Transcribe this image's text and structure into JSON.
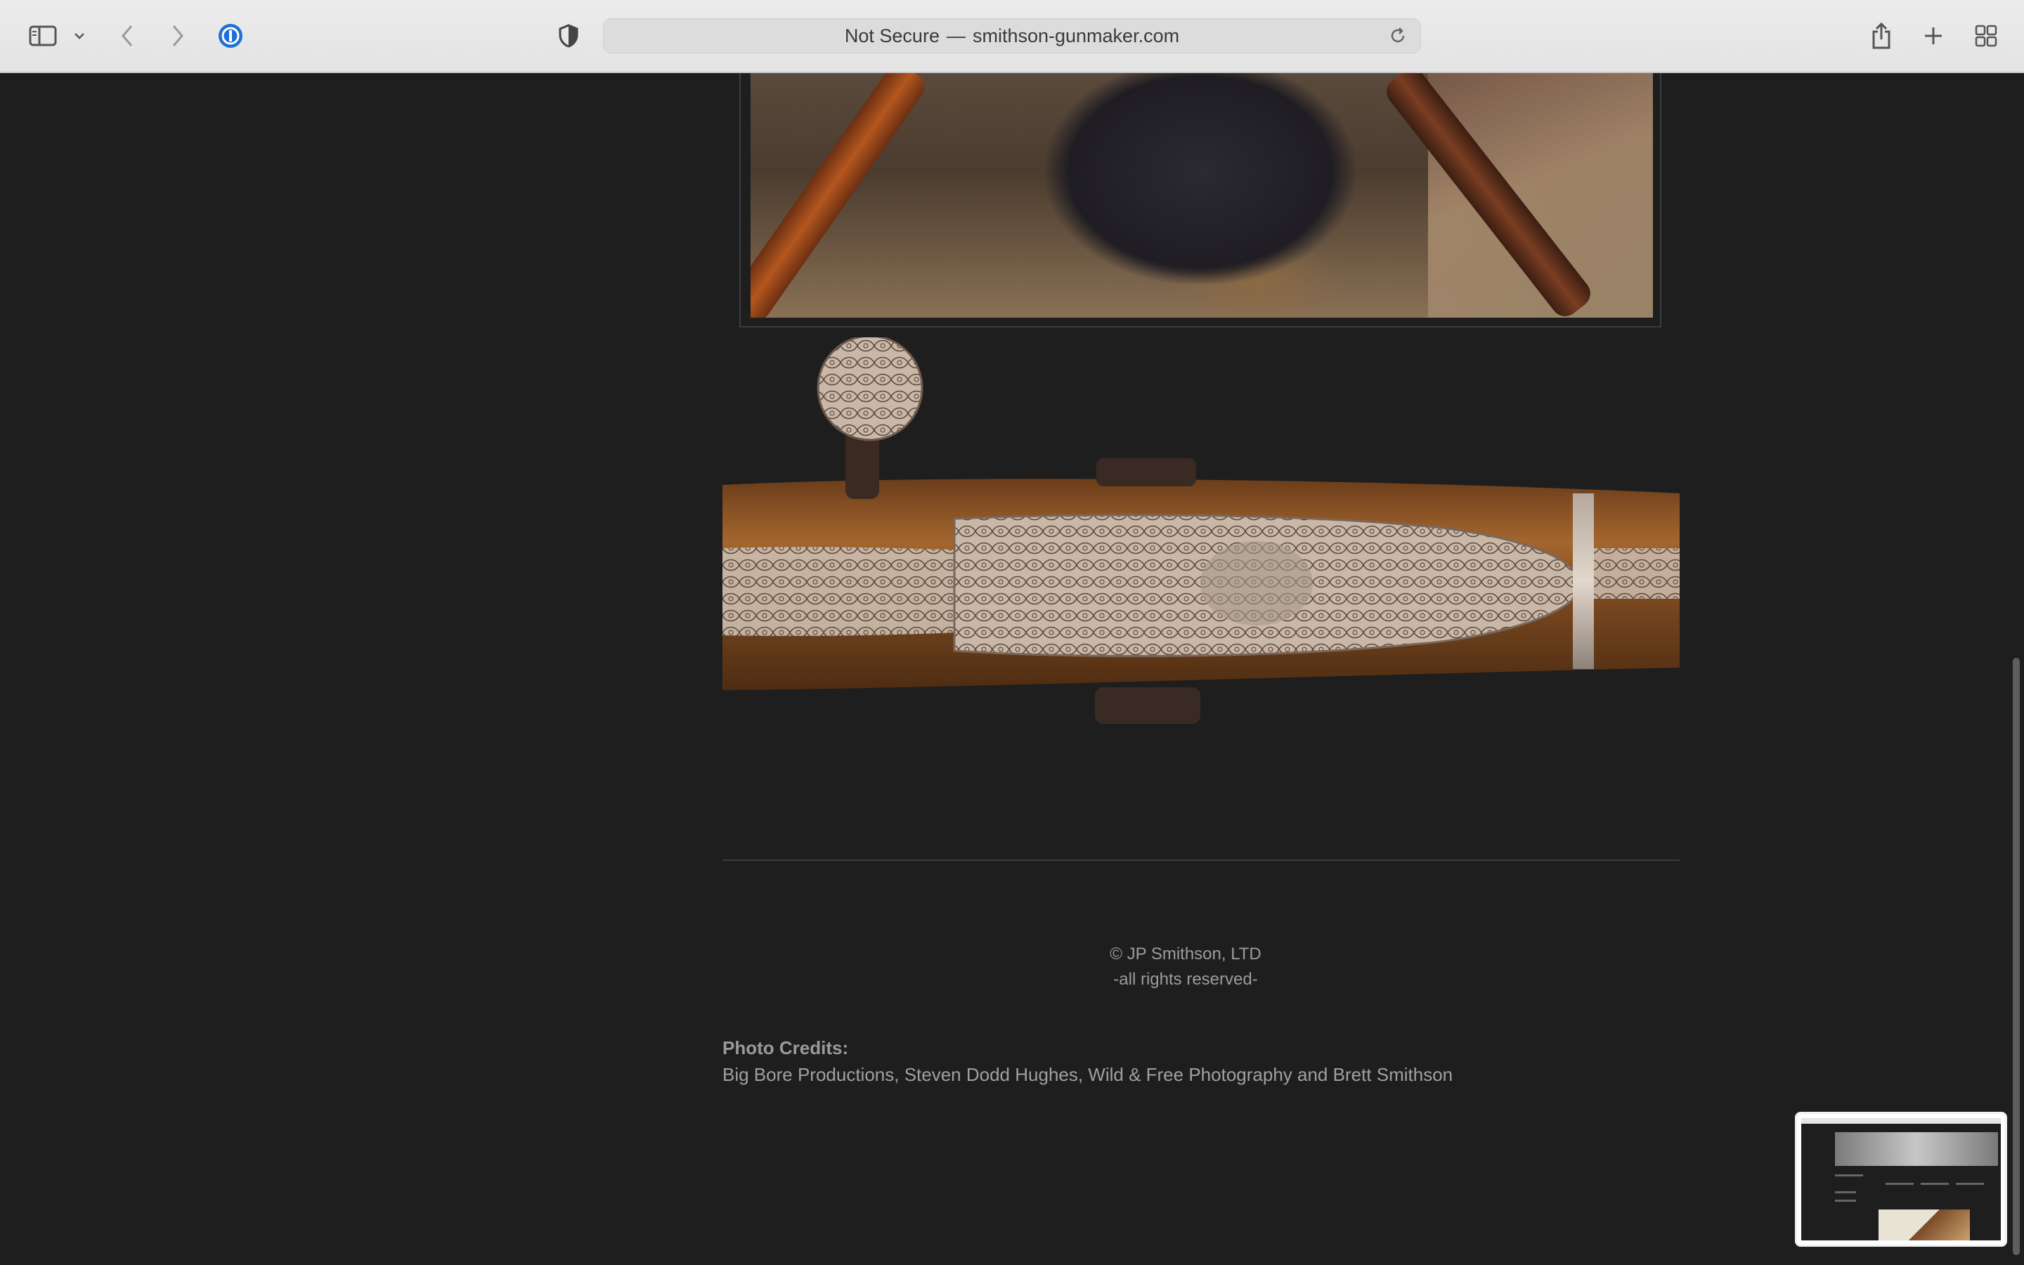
{
  "browser": {
    "address_prefix": "Not Secure",
    "address_separator": "—",
    "address_domain": "smithson-gunmaker.com",
    "icons": {
      "sidebar": "sidebar-icon",
      "sidebar_menu": "chevron-down-icon",
      "back": "chevron-left-icon",
      "forward": "chevron-right-icon",
      "password_manager": "onepassword-icon",
      "privacy": "shield-icon",
      "reload": "reload-icon",
      "share": "share-icon",
      "new_tab": "plus-icon",
      "tab_overview": "grid-icon"
    }
  },
  "page": {
    "copyright_line1": "©  JP Smithson, LTD",
    "copyright_line2": "-all rights reserved-",
    "credits_label": "Photo Credits:",
    "credits_text": "Big Bore Productions, Steven Dodd Hughes, Wild & Free Photography and Brett Smithson"
  },
  "colors": {
    "page_background": "#1e1e1e",
    "toolbar_background": "#e6e6e6",
    "accent_blue": "#1f6fd6"
  }
}
